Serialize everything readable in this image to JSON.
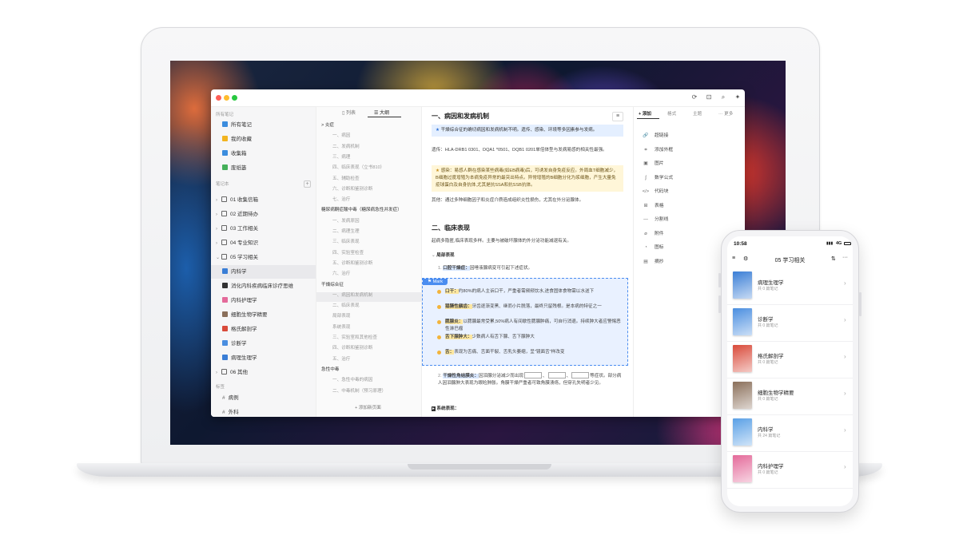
{
  "sidebar": {
    "section_all": "所有笔记",
    "items_top": [
      {
        "label": "所有笔记",
        "color": "#3c8dde"
      },
      {
        "label": "我的收藏",
        "color": "#f2b420"
      },
      {
        "label": "收集箱",
        "color": "#3c8dde"
      },
      {
        "label": "废纸篓",
        "color": "#45b05a"
      }
    ],
    "section_notebooks": "笔记本",
    "add_label": "+",
    "notebooks": [
      {
        "label": "01 收集信箱"
      },
      {
        "label": "02 近期待办"
      },
      {
        "label": "03 工作相关"
      },
      {
        "label": "04 专业知识"
      },
      {
        "label": "05 学习相关"
      }
    ],
    "subitems": [
      {
        "label": "内科学"
      },
      {
        "label": "消化内科疾病临床诊疗思维"
      },
      {
        "label": "内科护理学"
      },
      {
        "label": "细胞生物学精要"
      },
      {
        "label": "格氏解剖学"
      },
      {
        "label": "诊断学"
      },
      {
        "label": "病理生理学"
      }
    ],
    "after": {
      "label": "06 其他"
    },
    "section_tags": "标签",
    "tags": [
      {
        "label": "病例"
      },
      {
        "label": "外科"
      }
    ]
  },
  "outline": {
    "tab_list": "列表",
    "tab_outline": "大纲",
    "items": [
      {
        "label": "> 炎症",
        "head": true
      },
      {
        "label": "一、病因",
        "head": false
      },
      {
        "label": "二、发病机制",
        "head": false
      },
      {
        "label": "三、病理",
        "head": false
      },
      {
        "label": "四、临床表现（立书810）",
        "head": false
      },
      {
        "label": "五、辅助检查",
        "head": false
      },
      {
        "label": "六、诊断和鉴别诊断",
        "head": false
      },
      {
        "label": "七、治疗",
        "head": false
      },
      {
        "label": "糖尿病酮症酸中毒（糖尿病急性并发症）",
        "head": true
      },
      {
        "label": "一、发病原因",
        "head": false
      },
      {
        "label": "二、病理生理",
        "head": false
      },
      {
        "label": "三、临床表现",
        "head": false
      },
      {
        "label": "四、实验室检查",
        "head": false
      },
      {
        "label": "五、诊断和鉴别诊断",
        "head": false
      },
      {
        "label": "六、治疗",
        "head": false
      },
      {
        "label": "干燥综合征",
        "head": true
      },
      {
        "label": "一、病因和发病机制",
        "head": false
      },
      {
        "label": "二、临床表现",
        "head": false
      },
      {
        "label": "局部表现",
        "head": false
      },
      {
        "label": "系统表现",
        "head": false
      },
      {
        "label": "三、实验室和其他检查",
        "head": false
      },
      {
        "label": "四、诊断和鉴别诊断",
        "head": false
      },
      {
        "label": "五、治疗",
        "head": false
      },
      {
        "label": "急性中毒",
        "head": true
      },
      {
        "label": "一、急性中毒的病因",
        "head": false
      },
      {
        "label": "二、中毒机制（预习原理）",
        "head": false
      }
    ],
    "add_page": "+ 添加新页面"
  },
  "editor": {
    "menu_icon": "menu-icon",
    "h1": "一、病因和发病机制",
    "callout1": "干燥综合征的确切病因和发病机制不明。遗传、感染、环境等多因素参与发病。",
    "p1": "遗传：HLA-DRB1 0301、DQA1 *0501、DQB1 0201单倍体型与发病易感的相关性最强。",
    "callout2": "感染：易感人群在感染某些病毒(如EB病毒)后，可诱发自身免疫反应。外周血T细胞减少，B细胞过度增殖为本病免疫异常的最突出特点。异常增殖的B细胞分化为浆细胞，产生大量免疫球蛋白及自身抗体,尤其是抗SSA和抗SSB抗体。",
    "p2": "其他：通过多种细胞因子和炎症介质造成组织炎性损伤，尤其在外分泌腺体。",
    "h2": "二、临床表现",
    "p3": "起病多隐匿,临床表现多样。主要与被破坏腺体的外分泌功能减退有关。",
    "sub_local": "局部表现",
    "item1_hl": "口腔干燥症：",
    "item1_rest": "因唾液腺病变可引起下述症状。",
    "mark_label": "Mark",
    "marks": [
      {
        "hl": "口干：",
        "rest": "约80%的病人主诉口干，严重者需频频饮水,进食固体食物需以水送下"
      },
      {
        "hl": "猖獗性龋齿：",
        "rest": "牙齿逐渐变黑、继而小片脱落，最终只留残根。是本病的特征之一"
      },
      {
        "hl": "腮腺炎：",
        "rest": "以腮腺最常受累,50%病人有间歇性腮腺肿痛，可自行消退。持续肿大者应警惕恶性淋巴瘤"
      },
      {
        "hl": "舌下腺肿大：",
        "rest": "少数病人有舌下腺、舌下腺肿大"
      },
      {
        "hl": "舌：",
        "rest": "表现为舌痛、舌面干裂、舌乳头萎缩，呈\"镜面舌\"样改变"
      }
    ],
    "item2_hl": "干燥性角结膜炎：",
    "item2_rest_a": "因泪腺分泌减少而出现",
    "item2_rest_b": "等症状。部分病人因泪腺肿大表现为眼睑肿胀。角膜干燥严重者可致角膜溃疡，但穿孔失明者少见。",
    "sub_system": "系统表现："
  },
  "rpanel": {
    "tabs": [
      "+ 添加",
      "格式",
      "主题",
      "··· 更多"
    ],
    "items": [
      {
        "icon": "link-icon",
        "glyph": "🔗",
        "label": "超链接"
      },
      {
        "icon": "frame-icon",
        "glyph": "⌗",
        "label": "添加外框"
      },
      {
        "icon": "image-icon",
        "glyph": "▣",
        "label": "图片"
      },
      {
        "icon": "formula-icon",
        "glyph": "∫",
        "label": "数学公式"
      },
      {
        "icon": "code-icon",
        "glyph": "</>",
        "label": "代码块"
      },
      {
        "icon": "table-icon",
        "glyph": "⊞",
        "label": "表格"
      },
      {
        "icon": "divider-icon",
        "glyph": "—",
        "label": "分割线"
      },
      {
        "icon": "attachment-icon",
        "glyph": "⌀",
        "label": "附件"
      },
      {
        "icon": "chart-icon",
        "glyph": "◔",
        "label": "图标"
      },
      {
        "icon": "excerpt-icon",
        "glyph": "▤",
        "label": "摘抄"
      }
    ]
  },
  "phone": {
    "time": "10:58",
    "network": "4G",
    "title": "05 学习相关",
    "books": [
      {
        "title": "病理生理学",
        "sub": "共 0 篇笔记",
        "color": "#3a7ed6"
      },
      {
        "title": "诊断学",
        "sub": "共 0 篇笔记",
        "color": "#4a8ee0"
      },
      {
        "title": "格氏解剖学",
        "sub": "共 0 篇笔记",
        "color": "#d94a3a"
      },
      {
        "title": "细胞生物学精要",
        "sub": "共 0 篇笔记",
        "color": "#8a6f5a"
      },
      {
        "title": "内科学",
        "sub": "共 24 篇笔记",
        "color": "#5aa0e6"
      },
      {
        "title": "内科护理学",
        "sub": "共 0 篇笔记",
        "color": "#e46a9a"
      }
    ]
  }
}
